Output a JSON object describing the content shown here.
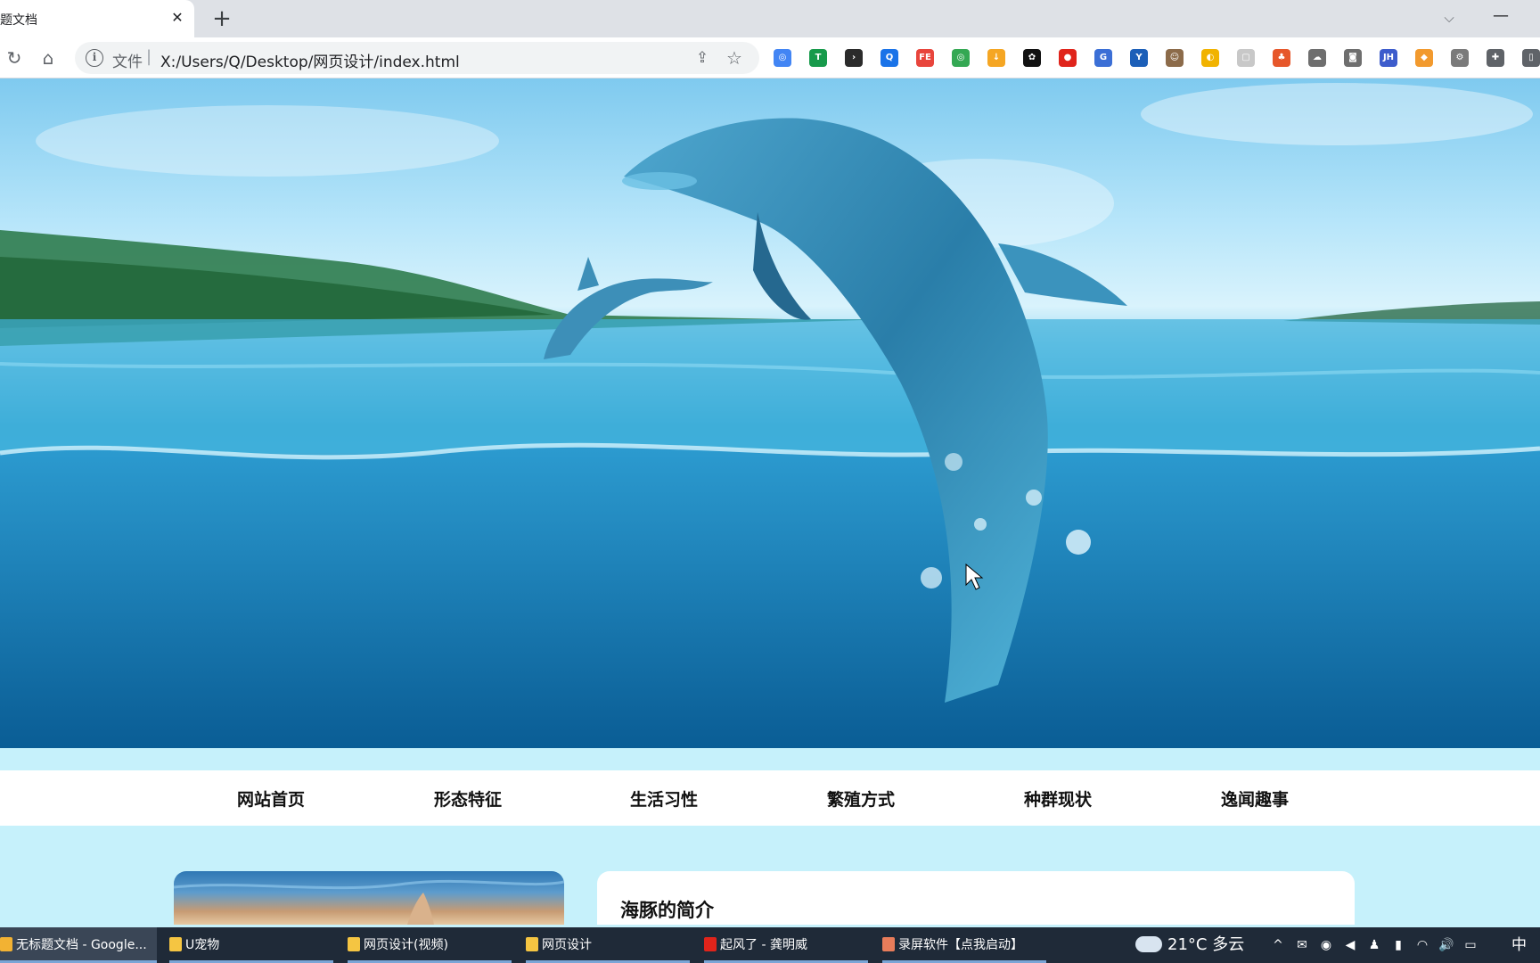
{
  "browser": {
    "tab_title": "无标题文档",
    "tab_close": "✕",
    "new_tab": "+",
    "tab_search_icon": "⌵",
    "minimize": "—",
    "address_scheme": "文件",
    "address_sep": "|",
    "address_url": "X:/Users/Q/Desktop/网页设计/index.html",
    "reload_icon": "↻",
    "home_icon": "⌂",
    "share_icon": "⇪",
    "star_icon": "☆",
    "extensions": [
      {
        "name": "chrome-ext",
        "glyph": "◎",
        "color": "#4285f4"
      },
      {
        "name": "adguard-ext",
        "glyph": "T",
        "color": "#179a4b"
      },
      {
        "name": "terminal-ext",
        "glyph": "›",
        "color": "#2b2b2b"
      },
      {
        "name": "search-ext",
        "glyph": "Q",
        "color": "#1a73e8"
      },
      {
        "name": "fe-helper-ext",
        "glyph": "FE",
        "color": "#e8453c"
      },
      {
        "name": "chrome-color-ext",
        "glyph": "◎",
        "color": "#34a853"
      },
      {
        "name": "download-ext",
        "glyph": "↓",
        "color": "#f5a623"
      },
      {
        "name": "openai-ext",
        "glyph": "✿",
        "color": "#111111"
      },
      {
        "name": "stop-ext",
        "glyph": "●",
        "color": "#e0241b"
      },
      {
        "name": "g-ext",
        "glyph": "G",
        "color": "#3b6fd6"
      },
      {
        "name": "y-ext",
        "glyph": "Y",
        "color": "#1c5fb8"
      },
      {
        "name": "face-ext",
        "glyph": "☺",
        "color": "#8c6b4a"
      },
      {
        "name": "yellow-ext",
        "glyph": "◐",
        "color": "#f1b300"
      },
      {
        "name": "puzzle-grey-ext",
        "glyph": "▢",
        "color": "#c8c8c8"
      },
      {
        "name": "tree-ext",
        "glyph": "♣",
        "color": "#e6572b"
      },
      {
        "name": "cloud-ext",
        "glyph": "☁",
        "color": "#6e6e6e"
      },
      {
        "name": "camera-ext",
        "glyph": "◙",
        "color": "#6e6e6e"
      },
      {
        "name": "jh-ext",
        "glyph": "JH",
        "color": "#3d5ccc"
      },
      {
        "name": "fox-ext",
        "glyph": "◆",
        "color": "#f29a2e"
      },
      {
        "name": "settings-ext",
        "glyph": "⚙",
        "color": "#7a7a7a"
      },
      {
        "name": "extensions-puzzle",
        "glyph": "✚",
        "color": "#5f6368"
      },
      {
        "name": "side-panel",
        "glyph": "▯",
        "color": "#5f6368"
      }
    ]
  },
  "nav": {
    "items": [
      {
        "label": "网站首页"
      },
      {
        "label": "形态特征"
      },
      {
        "label": "生活习性"
      },
      {
        "label": "繁殖方式"
      },
      {
        "label": "种群现状"
      },
      {
        "label": "逸闻趣事"
      }
    ]
  },
  "intro": {
    "title": "海豚的简介"
  },
  "taskbar": {
    "tasks": [
      {
        "label": "无标题文档 - Google...",
        "icon_color": "#f2b233"
      },
      {
        "label": "U宠物",
        "icon_color": "#f5c542"
      },
      {
        "label": "网页设计(视频)",
        "icon_color": "#f5c542"
      },
      {
        "label": "网页设计",
        "icon_color": "#f5c542"
      },
      {
        "label": "起风了 - 龚明威",
        "icon_color": "#e0241b"
      },
      {
        "label": "录屏软件【点我启动】",
        "icon_color": "#e87c5a"
      }
    ],
    "weather": "21°C 多云",
    "ime": "中",
    "tray": [
      "^",
      "✉",
      "◉",
      "◀",
      "♟",
      "▮",
      "◠",
      "🔊",
      "▭"
    ]
  }
}
